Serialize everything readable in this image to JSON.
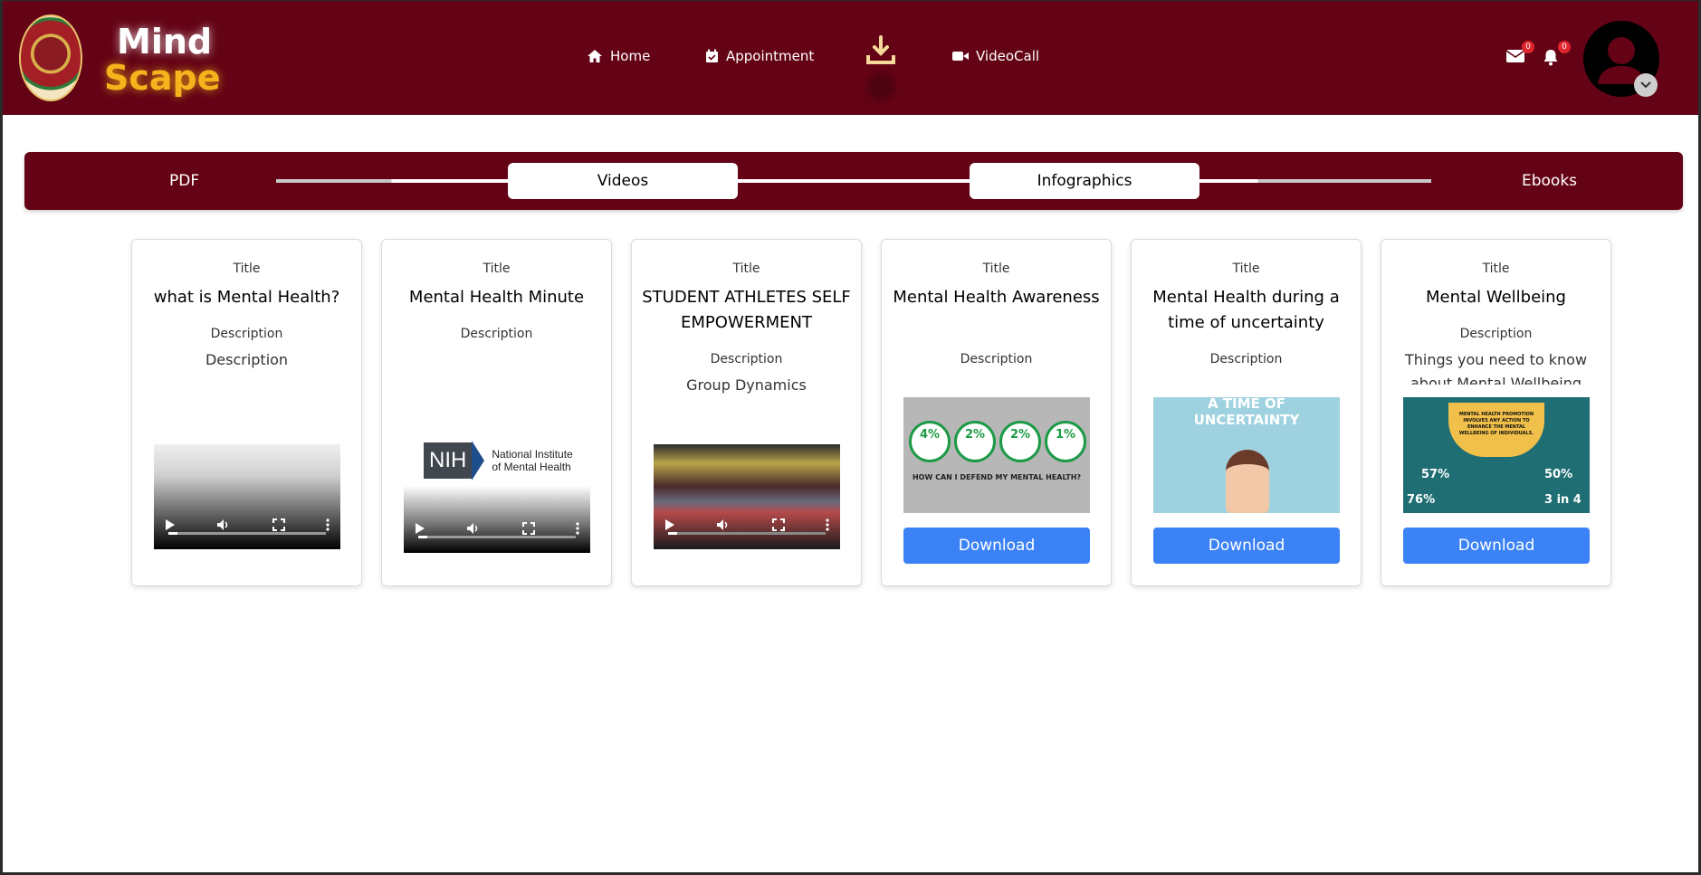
{
  "brand": {
    "line1": "Mind",
    "line2": "Scape"
  },
  "nav": {
    "home": "Home",
    "appointment": "Appointment",
    "videocall": "VideoCall"
  },
  "header": {
    "mail_count": "0",
    "notif_count": "0"
  },
  "tabs": {
    "pdf": "PDF",
    "videos": "Videos",
    "infographics": "Infographics",
    "ebooks": "Ebooks"
  },
  "cards": [
    {
      "label_title": "Title",
      "title": "what is Mental Health?",
      "label_desc": "Description",
      "desc": "Description",
      "media": "video"
    },
    {
      "label_title": "Title",
      "title": "Mental Health Minute",
      "label_desc": "Description",
      "desc": "",
      "media": "video"
    },
    {
      "label_title": "Title",
      "title": "STUDENT ATHLETES SELF EMPOWERMENT",
      "label_desc": "Description",
      "desc": "Group Dynamics",
      "media": "video"
    },
    {
      "label_title": "Title",
      "title": "Mental Health Awareness",
      "label_desc": "Description",
      "desc": "",
      "media": "image",
      "button": "Download"
    },
    {
      "label_title": "Title",
      "title": "Mental Health during a time of uncertainty",
      "label_desc": "Description",
      "desc": "",
      "media": "image",
      "button": "Download"
    },
    {
      "label_title": "Title",
      "title": "Mental Wellbeing",
      "label_desc": "Description",
      "desc": "Things you need to know about Mental Wellbeing",
      "media": "image",
      "button": "Download"
    }
  ],
  "thumbnails": {
    "nih_abbr": "NIH",
    "nih_line1": "National Institute",
    "nih_line2": "of Mental Health",
    "awareness_stats": [
      "4%",
      "2%",
      "2%",
      "1%"
    ],
    "awareness_question": "HOW CAN I DEFEND MY MENTAL HEALTH?",
    "uncertainty_heading": "A TIME OF UNCERTAINTY",
    "wellbeing_banner": "MENTAL HEALTH PROMOTION INVOLVES ANY ACTION TO ENHANCE THE MENTAL WELLBEING OF INDIVIDUALS.",
    "wellbeing_stats": [
      "57%",
      "50%",
      "76%",
      "3 in 4"
    ]
  },
  "colors": {
    "header_bg": "#640315",
    "brand_accent": "#f5b41c",
    "button_blue": "#3b82f6",
    "badge_red": "#e1252d"
  }
}
